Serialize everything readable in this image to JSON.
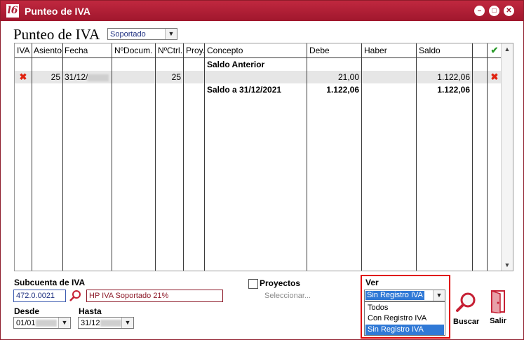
{
  "window": {
    "title": "Punteo de IVA",
    "logo_text": "l6",
    "controls": [
      "minimize-icon",
      "restore-icon",
      "close-icon"
    ]
  },
  "header": {
    "page_title": "Punteo de IVA",
    "type_select": "Soportado"
  },
  "table": {
    "columns": [
      "IVA",
      "Asiento",
      "Fecha",
      "NºDocum.",
      "NºCtrl.",
      "Proy.",
      "Concepto",
      "Debe",
      "Haber",
      "Saldo"
    ],
    "check_icon": "check-icon",
    "rows": [
      {
        "iva": "",
        "asiento": "",
        "fecha": "",
        "documento": "",
        "control": "",
        "proyecto": "",
        "concepto": "Saldo Anterior",
        "debe": "",
        "haber": "",
        "saldo": ""
      },
      {
        "iva": "x-icon",
        "asiento": "25",
        "fecha": "31/12/",
        "documento": "",
        "control": "25",
        "proyecto": "",
        "concepto": "",
        "debe": "21,00",
        "haber": "",
        "saldo": "1.122,06",
        "mark": "x-icon"
      },
      {
        "iva": "",
        "asiento": "",
        "fecha": "",
        "documento": "",
        "control": "",
        "proyecto": "",
        "concepto": "Saldo a 31/12/2021",
        "debe": "1.122,06",
        "haber": "",
        "saldo": "1.122,06"
      }
    ]
  },
  "footer": {
    "subcuenta_label": "Subcuenta de IVA",
    "subcuenta_value": "472.0.0021",
    "subcuenta_desc": "HP IVA Soportado 21%",
    "proyectos_label": "Proyectos",
    "proyectos_placeholder": "Seleccionar...",
    "desde_label": "Desde",
    "desde_value": "01/01",
    "hasta_label": "Hasta",
    "hasta_value": "31/12",
    "ver_label": "Ver",
    "ver_selected": "Sin Registro IVA",
    "ver_options": [
      "Todos",
      "Con Registro IVA",
      "Sin Registro IVA"
    ],
    "buscar_label": "Buscar",
    "salir_label": "Salir"
  },
  "colors": {
    "titlebar": "#a0172d",
    "highlight": "#e00000",
    "selection": "#3079d6"
  }
}
